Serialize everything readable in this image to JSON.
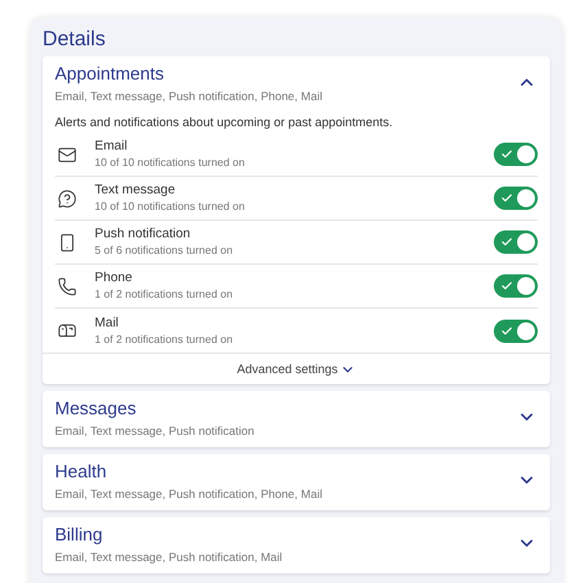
{
  "title": "Details",
  "sections": [
    {
      "name": "Appointments",
      "summary": "Email, Text message, Push notification, Phone, Mail",
      "expanded": true,
      "description": "Alerts and notifications about upcoming or past appointments.",
      "channels": [
        {
          "kind": "email",
          "name": "Email",
          "status": "10 of 10 notifications turned on",
          "on": true
        },
        {
          "kind": "text",
          "name": "Text message",
          "status": "10 of 10 notifications turned on",
          "on": true
        },
        {
          "kind": "push",
          "name": "Push notification",
          "status": "5 of 6 notifications turned on",
          "on": true
        },
        {
          "kind": "phone",
          "name": "Phone",
          "status": "1 of 2 notifications turned on",
          "on": true
        },
        {
          "kind": "mail",
          "name": "Mail",
          "status": "1 of 2 notifications turned on",
          "on": true
        }
      ],
      "advanced": "Advanced settings"
    },
    {
      "name": "Messages",
      "summary": "Email, Text message, Push notification",
      "expanded": false
    },
    {
      "name": "Health",
      "summary": "Email, Text message, Push notification, Phone, Mail",
      "expanded": false
    },
    {
      "name": "Billing",
      "summary": "Email, Text message, Push notification, Mail",
      "expanded": false
    }
  ]
}
